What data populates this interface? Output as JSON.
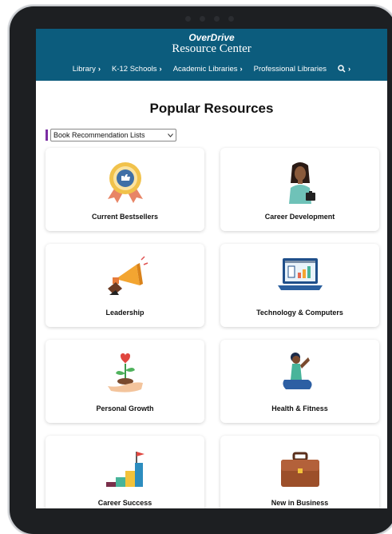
{
  "header": {
    "brand": "OverDrive",
    "subtitle": "Resource Center"
  },
  "nav": {
    "items": [
      {
        "label": "Library"
      },
      {
        "label": "K-12 Schools"
      },
      {
        "label": "Academic Libraries"
      },
      {
        "label": "Professional Libraries"
      }
    ],
    "search_icon": "search-icon"
  },
  "main": {
    "title": "Popular Resources",
    "select": {
      "value": "Book Recommendation Lists"
    },
    "cards": [
      {
        "label": "Current Bestsellers",
        "icon": "award-ribbon-icon"
      },
      {
        "label": "Career Development",
        "icon": "professional-person-icon"
      },
      {
        "label": "Leadership",
        "icon": "megaphone-icon"
      },
      {
        "label": "Technology & Computers",
        "icon": "laptop-chart-icon"
      },
      {
        "label": "Personal Growth",
        "icon": "sprouting-plant-icon"
      },
      {
        "label": "Health & Fitness",
        "icon": "yoga-person-icon"
      },
      {
        "label": "Career Success",
        "icon": "steps-flag-icon"
      },
      {
        "label": "New in Business",
        "icon": "briefcase-icon"
      }
    ]
  },
  "colors": {
    "header_bg": "#0c5c7d",
    "accent_purple": "#7b2ea3"
  }
}
